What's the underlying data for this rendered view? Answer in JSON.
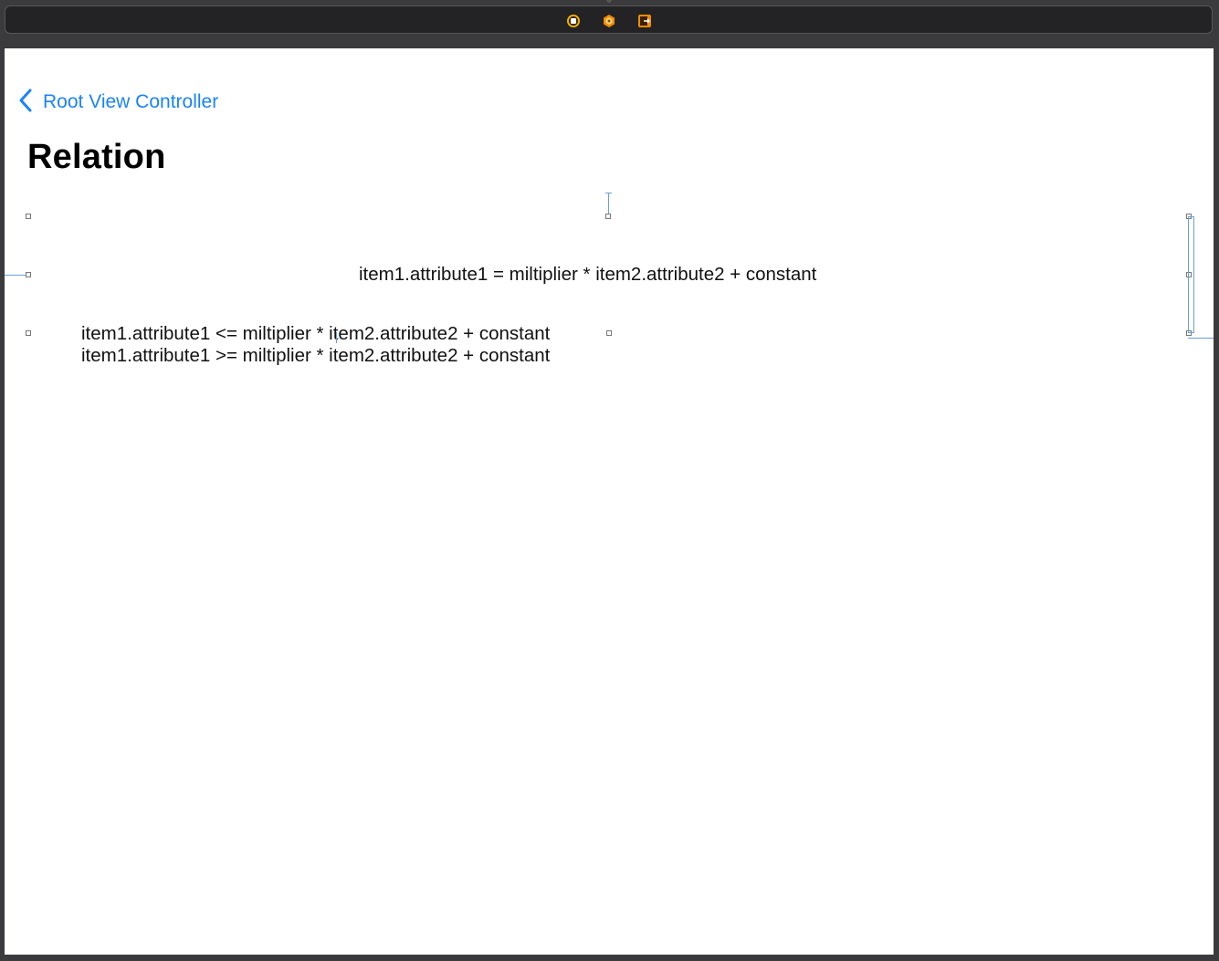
{
  "scene_dock": {
    "icons": [
      {
        "name": "view-controller-icon",
        "color": "#f5b400"
      },
      {
        "name": "first-responder-icon",
        "color": "#f08c00"
      },
      {
        "name": "exit-icon",
        "color": "#f08c00"
      }
    ]
  },
  "nav": {
    "back_label": "Root View Controller",
    "title": "Relation"
  },
  "labels": {
    "equal": "item1.attribute1 = miltiplier * item2.attribute2 + constant",
    "less_equal": "item1.attribute1 <= miltiplier * item2.attribute2 + constant",
    "greater_equal": "item1.attribute1 >= miltiplier * item2.attribute2 + constant"
  },
  "colors": {
    "accent": "#1a82fb",
    "guide": "#6aa0d8"
  }
}
